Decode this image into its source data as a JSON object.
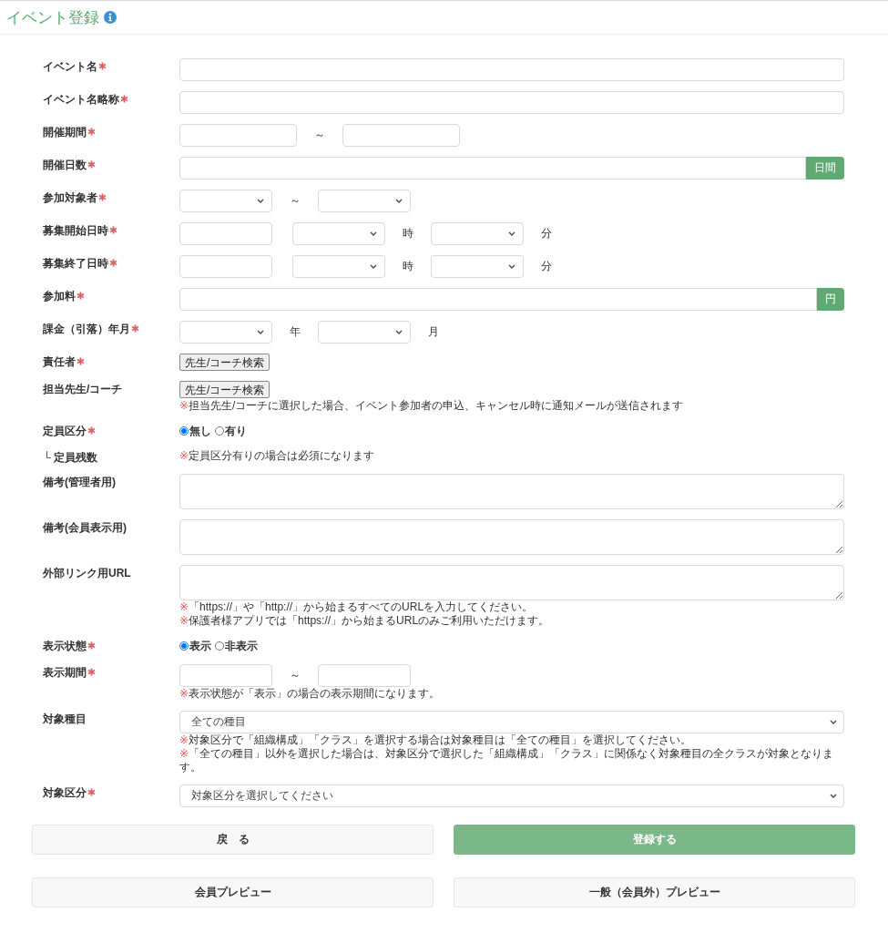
{
  "header": {
    "title": "イベント登録"
  },
  "rows": [
    {
      "label": "イベント名",
      "required": true,
      "controls": [
        {
          "kind": "text"
        }
      ]
    },
    {
      "label": "イベント名略称",
      "required": true,
      "controls": [
        {
          "kind": "text"
        }
      ]
    },
    {
      "label": "開催期間",
      "required": true,
      "controls": [
        {
          "kind": "date"
        },
        {
          "kind": "sep",
          "text": "～"
        },
        {
          "kind": "date"
        }
      ]
    },
    {
      "label": "開催日数",
      "required": true,
      "controls": [
        {
          "kind": "addon",
          "addon": "日間"
        }
      ]
    },
    {
      "label": "参加対象者",
      "required": true,
      "controls": [
        {
          "kind": "select"
        },
        {
          "kind": "sep",
          "text": "～"
        },
        {
          "kind": "select"
        }
      ]
    },
    {
      "label": "募集開始日時",
      "required": true,
      "controls": [
        {
          "kind": "input"
        },
        {
          "kind": "select"
        },
        {
          "kind": "unit",
          "text": "時"
        },
        {
          "kind": "select"
        },
        {
          "kind": "unit",
          "text": "分"
        }
      ]
    },
    {
      "label": "募集終了日時",
      "required": true,
      "controls": [
        {
          "kind": "input"
        },
        {
          "kind": "select"
        },
        {
          "kind": "unit",
          "text": "時"
        },
        {
          "kind": "select"
        },
        {
          "kind": "unit",
          "text": "分"
        }
      ]
    },
    {
      "label": "参加料",
      "required": true,
      "controls": [
        {
          "kind": "addon",
          "addon": "円"
        }
      ]
    },
    {
      "label": "課金（引落）年月",
      "required": true,
      "controls": [
        {
          "kind": "select"
        },
        {
          "kind": "unit",
          "text": "年"
        },
        {
          "kind": "select"
        },
        {
          "kind": "unit",
          "text": "月"
        }
      ]
    },
    {
      "label": "責任者",
      "required": true,
      "controls": [
        {
          "kind": "button",
          "text": "先生/コーチ検索"
        }
      ]
    },
    {
      "label": "担当先生/コーチ",
      "required": false,
      "controls": [
        {
          "kind": "button",
          "text": "先生/コーチ検索"
        }
      ],
      "notes": [
        {
          "mark": "※",
          "text": "担当先生/コーチに選択した場合、イベント参加者の申込、キャンセル時に通知メールが送信されます"
        }
      ]
    },
    {
      "label": "定員区分",
      "required": true,
      "controls": [
        {
          "kind": "radio",
          "options": [
            {
              "label": "無し",
              "selected": true
            },
            {
              "label": "有り",
              "selected": false
            }
          ]
        }
      ]
    },
    {
      "label": "└ 定員残数",
      "required": false,
      "notes": [
        {
          "mark": "※",
          "text": "定員区分有りの場合は必須になります"
        }
      ]
    },
    {
      "label": "備考(管理者用)",
      "required": false,
      "controls": [
        {
          "kind": "textarea"
        }
      ]
    },
    {
      "label": "備考(会員表示用)",
      "required": false,
      "controls": [
        {
          "kind": "textarea"
        }
      ]
    },
    {
      "label": "外部リンク用URL",
      "required": false,
      "controls": [
        {
          "kind": "textarea"
        }
      ],
      "notes": [
        {
          "mark": "※",
          "text": "「https://」や「http://」から始まるすべてのURLを入力してください。"
        },
        {
          "mark": "※",
          "text": "保護者様アプリでは「https://」から始まるURLのみご利用いただけます。"
        }
      ]
    },
    {
      "label": "表示状態",
      "required": true,
      "controls": [
        {
          "kind": "radio",
          "options": [
            {
              "label": "表示",
              "selected": true
            },
            {
              "label": "非表示",
              "selected": false
            }
          ]
        }
      ]
    },
    {
      "label": "表示期間",
      "required": true,
      "controls": [
        {
          "kind": "input"
        },
        {
          "kind": "sep",
          "text": "～"
        },
        {
          "kind": "input"
        }
      ],
      "notes": [
        {
          "mark": "※",
          "text": "表示状態が「表示」の場合の表示期間になります。"
        }
      ]
    },
    {
      "label": "対象種目",
      "required": false,
      "controls": [
        {
          "kind": "select-wide",
          "value": "全ての種目"
        }
      ],
      "notes": [
        {
          "mark": "※",
          "text": "対象区分で「組織構成」「クラス」を選択する場合は対象種目は「全ての種目」を選択してください。"
        },
        {
          "mark": "※",
          "text": "「全ての種目」以外を選択した場合は、対象区分で選択した「組織構成」「クラス」に関係なく対象種目の全クラスが対象となります。"
        }
      ]
    },
    {
      "label": "対象区分",
      "required": true,
      "controls": [
        {
          "kind": "select-wide",
          "value": "対象区分を選択してください"
        }
      ]
    }
  ],
  "buttons": [
    {
      "label": "戻　る",
      "kind": "secondary"
    },
    {
      "label": "登録する",
      "kind": "primary"
    },
    {
      "label": "会員プレビュー",
      "kind": "secondary"
    },
    {
      "label": "一般（会員外）プレビュー",
      "kind": "secondary"
    }
  ]
}
